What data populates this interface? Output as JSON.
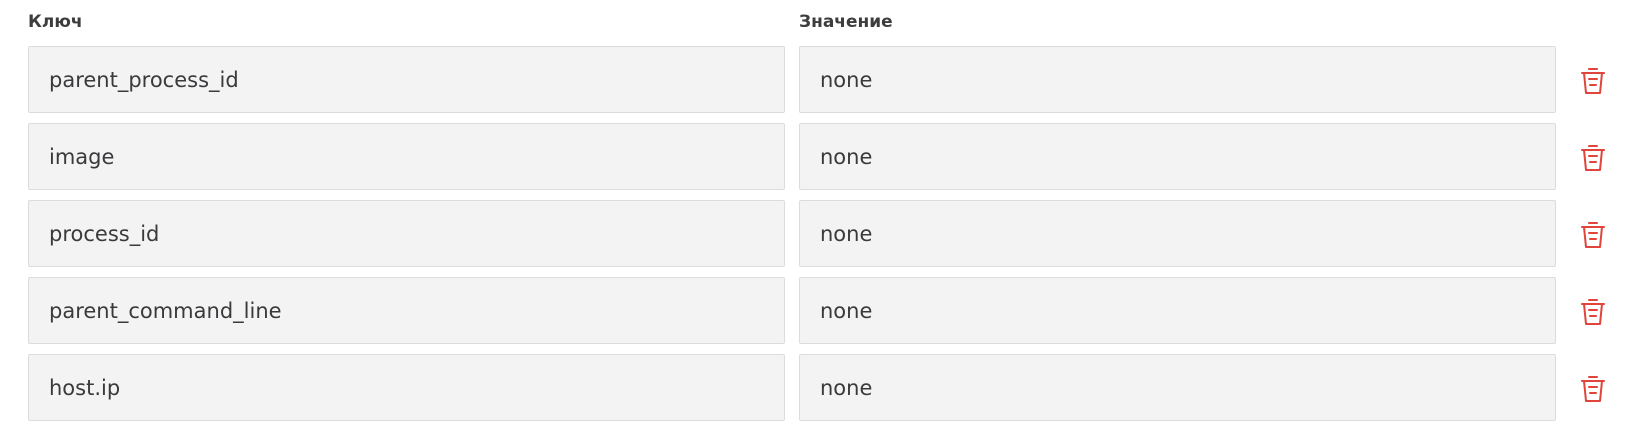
{
  "headers": {
    "key": "Ключ",
    "value": "Значение"
  },
  "rows": [
    {
      "key": "parent_process_id",
      "value": "none"
    },
    {
      "key": "image",
      "value": "none"
    },
    {
      "key": "process_id",
      "value": "none"
    },
    {
      "key": "parent_command_line",
      "value": "none"
    },
    {
      "key": "host.ip",
      "value": "none"
    }
  ],
  "icons": {
    "delete": "trash-icon"
  },
  "colors": {
    "delete_icon": "#e0443a",
    "field_bg": "#f3f3f4",
    "field_border": "#dcdcde",
    "text": "#3a3a3c"
  }
}
